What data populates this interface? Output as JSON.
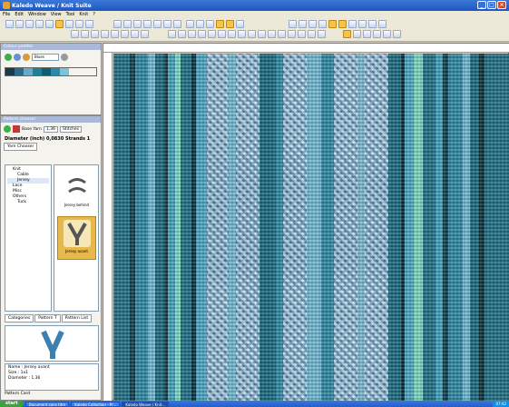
{
  "window": {
    "title": "Kaledo Weave / Knit Suite"
  },
  "menu": [
    "File",
    "Edit",
    "Window",
    "View",
    "Tool",
    "Knit",
    "?"
  ],
  "color_panel": {
    "title": "Colour palette",
    "select_value": "Blues",
    "swatches": [
      "#1b3a4a",
      "#2d6b86",
      "#6aa9c6",
      "#1f7f94",
      "#0f5e70",
      "#2c8aa6",
      "#7cc2d8"
    ]
  },
  "pattern_panel": {
    "title": "Pattern chooser",
    "base_yarn": "Base Yarn",
    "diameter_field": "1,36",
    "yarn_type": "Stitches",
    "diameter_label": "Diameter (inch)",
    "diameter_value": "0,0830",
    "strands_label": "Strands",
    "strands_value": "1",
    "tab_yarn": "Yarn Chooser",
    "tree": [
      {
        "label": "Knit",
        "cls": "leaf"
      },
      {
        "label": "Cable",
        "cls": "sub"
      },
      {
        "label": "Jersey",
        "cls": "sub"
      },
      {
        "label": "Lace",
        "cls": "leaf"
      },
      {
        "label": "Misc",
        "cls": "leaf"
      },
      {
        "label": "Others",
        "cls": "leaf"
      },
      {
        "label": "Tuck",
        "cls": "sub"
      }
    ],
    "thumb1": "Jersey behind",
    "thumb2": "Jersey avant",
    "tabs": [
      "Categories",
      "Pattern T",
      "Pattern List"
    ],
    "info": {
      "name": "Name : Jersey avant",
      "size": "Size : 1x1",
      "diameter": "Diameter : 1,36"
    },
    "card": "Pattern Card"
  },
  "taskbar": {
    "start": "start",
    "tasks": [
      "Document sans titre",
      "Kaledo Collection - Pr...",
      "Kaledo Weave / Knit..."
    ],
    "clock": "07:42"
  }
}
